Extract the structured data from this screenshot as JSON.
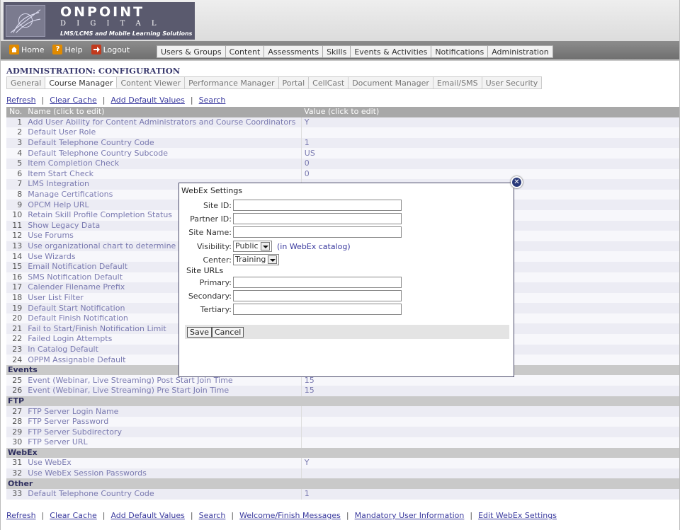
{
  "brand": {
    "name": "ONPOINT",
    "sub": "D I G I T A L",
    "tagline": "LMS/LCMS and Mobile Learning Solutions"
  },
  "quick_links": [
    {
      "label": "Home",
      "icon": "home-icon"
    },
    {
      "label": "Help",
      "icon": "help-icon"
    },
    {
      "label": "Logout",
      "icon": "logout-icon"
    }
  ],
  "main_nav": [
    "Users & Groups",
    "Content",
    "Assessments",
    "Skills",
    "Events & Activities",
    "Notifications",
    "Administration"
  ],
  "page_title": "ADMINISTRATION: CONFIGURATION",
  "sub_tabs": [
    {
      "label": "General",
      "active": false
    },
    {
      "label": "Course Manager",
      "active": true
    },
    {
      "label": "Content Viewer",
      "active": false
    },
    {
      "label": "Performance Manager",
      "active": false
    },
    {
      "label": "Portal",
      "active": false
    },
    {
      "label": "CellCast",
      "active": false
    },
    {
      "label": "Document Manager",
      "active": false
    },
    {
      "label": "Email/SMS",
      "active": false
    },
    {
      "label": "User Security",
      "active": false
    }
  ],
  "top_links": [
    "Refresh",
    "Clear Cache",
    "Add Default Values",
    "Search"
  ],
  "bottom_links": [
    "Refresh",
    "Clear Cache",
    "Add Default Values",
    "Search",
    "Welcome/Finish Messages",
    "Mandatory User Information",
    "Edit WebEx Settings"
  ],
  "table": {
    "headers": {
      "no": "No.",
      "name": "Name (click to edit)",
      "value": "Value (click to edit)"
    },
    "sections": [
      {
        "title": "",
        "rows": [
          {
            "no": "1",
            "name": "Add User Ability for Content Administrators and Course Coordinators",
            "value": "Y"
          },
          {
            "no": "2",
            "name": "Default User Role",
            "value": ""
          },
          {
            "no": "3",
            "name": "Default Telephone Country Code",
            "value": "1"
          },
          {
            "no": "4",
            "name": "Default Telephone Country Subcode",
            "value": "US"
          },
          {
            "no": "5",
            "name": "Item Completion Check",
            "value": "0"
          },
          {
            "no": "6",
            "name": "Item Start Check",
            "value": "0"
          },
          {
            "no": "7",
            "name": "LMS Integration",
            "value": ""
          },
          {
            "no": "8",
            "name": "Manage Certifications",
            "value": ""
          },
          {
            "no": "9",
            "name": "OPCM Help URL",
            "value": ""
          },
          {
            "no": "10",
            "name": "Retain Skill Profile Completion Status",
            "value": ""
          },
          {
            "no": "11",
            "name": "Show Legacy Data",
            "value": ""
          },
          {
            "no": "12",
            "name": "Use Forums",
            "value": ""
          },
          {
            "no": "13",
            "name": "Use organizational chart to determine man",
            "value": ""
          },
          {
            "no": "14",
            "name": "Use Wizards",
            "value": ""
          },
          {
            "no": "15",
            "name": "Email Notification Default",
            "value": ""
          },
          {
            "no": "16",
            "name": "SMS Notification Default",
            "value": ""
          },
          {
            "no": "17",
            "name": "Calender Filename Prefix",
            "value": ""
          },
          {
            "no": "18",
            "name": "User List Filter",
            "value": ""
          },
          {
            "no": "19",
            "name": "Default Start Notification",
            "value": ""
          },
          {
            "no": "20",
            "name": "Default Finish Notification",
            "value": ""
          },
          {
            "no": "21",
            "name": "Fail to Start/Finish Notification Limit",
            "value": ""
          },
          {
            "no": "22",
            "name": "Failed Login Attempts",
            "value": ""
          },
          {
            "no": "23",
            "name": "In Catalog Default",
            "value": ""
          },
          {
            "no": "24",
            "name": "OPPM Assignable Default",
            "value": ""
          }
        ]
      },
      {
        "title": "Events",
        "rows": [
          {
            "no": "25",
            "name": "Event (Webinar, Live Streaming) Post Start Join Time",
            "value": "15"
          },
          {
            "no": "26",
            "name": "Event (Webinar, Live Streaming) Pre Start Join Time",
            "value": "15"
          }
        ]
      },
      {
        "title": "FTP",
        "rows": [
          {
            "no": "27",
            "name": "FTP Server Login Name",
            "value": ""
          },
          {
            "no": "28",
            "name": "FTP Server Password",
            "value": ""
          },
          {
            "no": "29",
            "name": "FTP Server Subdirectory",
            "value": ""
          },
          {
            "no": "30",
            "name": "FTP Server URL",
            "value": ""
          }
        ]
      },
      {
        "title": "WebEx",
        "rows": [
          {
            "no": "31",
            "name": "Use WebEx",
            "value": "Y"
          },
          {
            "no": "32",
            "name": "Use WebEx Session Passwords",
            "value": ""
          }
        ]
      },
      {
        "title": "Other",
        "rows": [
          {
            "no": "33",
            "name": "Default Telephone Country Code",
            "value": "1"
          }
        ]
      }
    ]
  },
  "modal": {
    "title": "WebEx Settings",
    "close_icon": "close-icon",
    "fields": {
      "site_id": {
        "label": "Site ID:",
        "value": ""
      },
      "partner_id": {
        "label": "Partner ID:",
        "value": ""
      },
      "site_name": {
        "label": "Site Name:",
        "value": ""
      },
      "visibility": {
        "label": "Visibility:",
        "value": "Public",
        "hint": "(in WebEx catalog)"
      },
      "center": {
        "label": "Center:",
        "value": "Training"
      },
      "site_urls_heading": "Site URLs",
      "primary": {
        "label": "Primary:",
        "value": ""
      },
      "secondary": {
        "label": "Secondary:",
        "value": ""
      },
      "tertiary": {
        "label": "Tertiary:",
        "value": ""
      }
    },
    "save_label": "Save",
    "cancel_label": "Cancel"
  },
  "colors": {
    "link": "#3a3a9e",
    "title": "#3a3a6e",
    "header_row": "#a8a8a8",
    "topbar": "#7a7a7a",
    "close_button": "#2a3a7a"
  }
}
